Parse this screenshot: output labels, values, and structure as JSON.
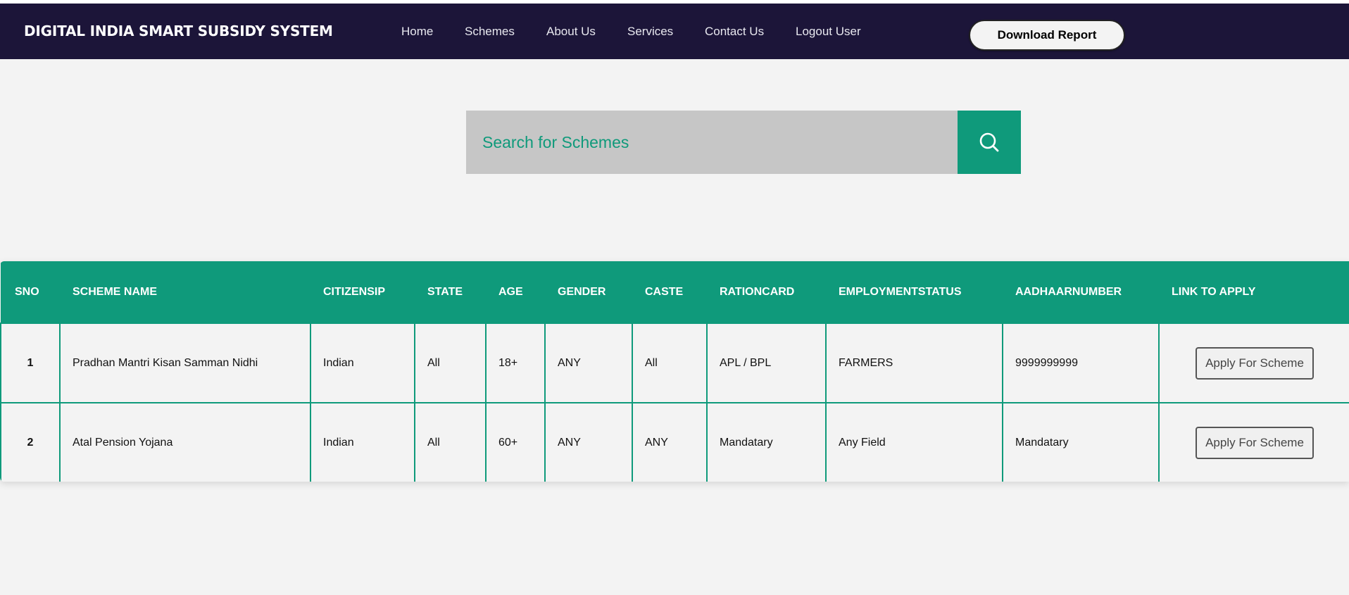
{
  "brand": "DIGITAL INDIA SMART SUBSIDY SYSTEM",
  "nav": {
    "home": "Home",
    "schemes": "Schemes",
    "about": "About Us",
    "services": "Services",
    "contact": "Contact Us",
    "logout": "Logout User",
    "download": "Download Report"
  },
  "search": {
    "placeholder": "Search for Schemes",
    "icon": "search-icon"
  },
  "colors": {
    "navbar": "#1c1539",
    "accent": "#0f9a7b",
    "search_bg": "#c6c6c6",
    "page_bg": "#f3f3f3"
  },
  "table": {
    "headers": {
      "sno": "SNO",
      "scheme_name": "SCHEME NAME",
      "citizenship": "CITIZENSIP",
      "state": "STATE",
      "age": "AGE",
      "gender": "GENDER",
      "caste": "CASTE",
      "rationcard": "RATIONCARD",
      "employment": "EMPLOYMENTSTATUS",
      "aadhaar": "AADHAARNUMBER",
      "link": "LINK TO APPLY"
    },
    "rows": [
      {
        "sno": "1",
        "scheme_name": "Pradhan Mantri Kisan Samman Nidhi",
        "citizenship": "Indian",
        "state": "All",
        "age": "18+",
        "gender": "ANY",
        "caste": "All",
        "rationcard": "APL / BPL",
        "employment": "FARMERS",
        "aadhaar": "9999999999",
        "apply": "Apply For Scheme"
      },
      {
        "sno": "2",
        "scheme_name": "Atal Pension Yojana",
        "citizenship": "Indian",
        "state": "All",
        "age": "60+",
        "gender": "ANY",
        "caste": "ANY",
        "rationcard": "Mandatary",
        "employment": "Any Field",
        "aadhaar": "Mandatary",
        "apply": "Apply For Scheme"
      }
    ]
  }
}
